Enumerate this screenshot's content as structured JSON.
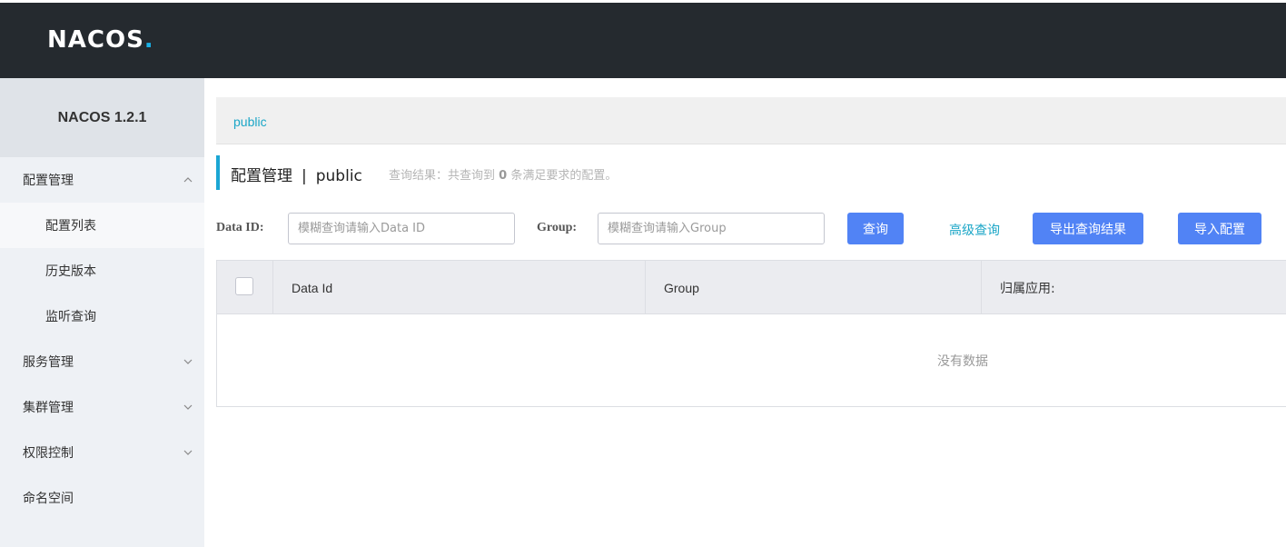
{
  "header": {
    "logo_text": "NACOS",
    "logo_dot": "."
  },
  "sidebar": {
    "version": "NACOS 1.2.1",
    "items": [
      {
        "label": "配置管理",
        "expanded": true
      },
      {
        "label": "配置列表",
        "active": true
      },
      {
        "label": "历史版本"
      },
      {
        "label": "监听查询"
      },
      {
        "label": "服务管理"
      },
      {
        "label": "集群管理"
      },
      {
        "label": "权限控制"
      },
      {
        "label": "命名空间"
      }
    ]
  },
  "breadcrumb": {
    "namespace": "public"
  },
  "page": {
    "title": "配置管理",
    "separator": "|",
    "namespace": "public",
    "result_prefix": "查询结果：共查询到",
    "result_count": "0",
    "result_suffix": "条满足要求的配置。"
  },
  "search": {
    "dataid_label": "Data ID:",
    "dataid_placeholder": "模糊查询请输入Data ID",
    "group_label": "Group:",
    "group_placeholder": "模糊查询请输入Group",
    "query_button": "查询",
    "advanced_link": "高级查询",
    "export_button": "导出查询结果",
    "import_button": "导入配置"
  },
  "table": {
    "columns": [
      "Data Id",
      "Group",
      "归属应用:"
    ],
    "empty_text": "没有数据"
  },
  "colors": {
    "header_bg": "#252a2f",
    "accent": "#1ba6d4",
    "button": "#5183f5",
    "link": "#1ba6c7"
  }
}
